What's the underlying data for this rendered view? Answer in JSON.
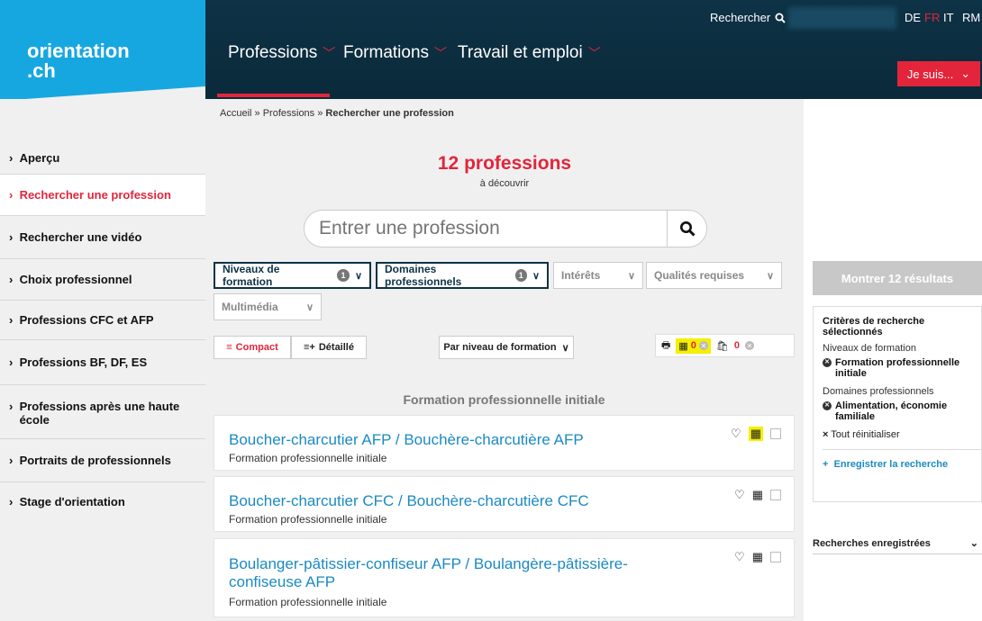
{
  "header": {
    "logo_line1": "orientation",
    "logo_line2": ".ch",
    "nav": [
      {
        "label": "Professions"
      },
      {
        "label": "Formations"
      },
      {
        "label": "Travail et emploi"
      }
    ],
    "search_label": "Rechercher",
    "languages": [
      "DE",
      "FR",
      "IT",
      "RM"
    ],
    "active_language": "FR",
    "je_suis": "Je suis..."
  },
  "sidebar": {
    "items": [
      {
        "label": "Aperçu"
      },
      {
        "label": "Rechercher une profession"
      },
      {
        "label": "Rechercher une vidéo"
      },
      {
        "label": "Choix professionnel"
      },
      {
        "label": "Professions CFC et AFP"
      },
      {
        "label": "Professions BF, DF, ES"
      },
      {
        "label": "Professions après une haute école"
      },
      {
        "label": "Portraits de professionnels"
      },
      {
        "label": "Stage d'orientation"
      }
    ]
  },
  "breadcrumb": {
    "home": "Accueil",
    "sep": " » ",
    "level1": "Professions",
    "current": "Rechercher une profession"
  },
  "results": {
    "count": "12 professions",
    "sub": "à découvrir"
  },
  "search": {
    "placeholder": "Entrer une profession"
  },
  "filters": [
    {
      "label": "Niveaux de formation",
      "badge": "1"
    },
    {
      "label": "Domaines professionnels",
      "badge": "1"
    },
    {
      "label": "Intérêts"
    },
    {
      "label": "Qualités requises"
    },
    {
      "label": "Multimédia"
    }
  ],
  "view": {
    "compact": "Compact",
    "detail": "Détaillé",
    "sort": "Par niveau de formation",
    "compare_count": "0",
    "bag_count": "0"
  },
  "section_title": "Formation professionnelle initiale",
  "cards": [
    {
      "title": "Boucher-charcutier AFP / Bouchère-charcutière AFP",
      "sub": "Formation professionnelle initiale"
    },
    {
      "title": "Boucher-charcutier CFC / Bouchère-charcutière CFC",
      "sub": "Formation professionnelle initiale"
    },
    {
      "title": "Boulanger-pâtissier-confiseur AFP / Boulangère-pâtissière-confiseuse AFP",
      "sub": "Formation professionnelle initiale"
    }
  ],
  "right": {
    "show_button": "Montrer 12 résultats",
    "criteria_title": "Critères de recherche sélectionnés",
    "group1_label": "Niveaux de formation",
    "group1_item": "Formation professionnelle initiale",
    "group2_label": "Domaines professionnels",
    "group2_item": "Alimentation, économie familiale",
    "reset": "Tout réinitialiser",
    "save": "Enregistrer la recherche",
    "saved_searches": "Recherches enregistrées"
  },
  "colors": {
    "brand_blue": "#17a7e0",
    "header_dark": "#0e3246",
    "accent_red": "#e2253b",
    "link_blue": "#1b8ac2",
    "highlight_yellow": "#f5ef00"
  }
}
